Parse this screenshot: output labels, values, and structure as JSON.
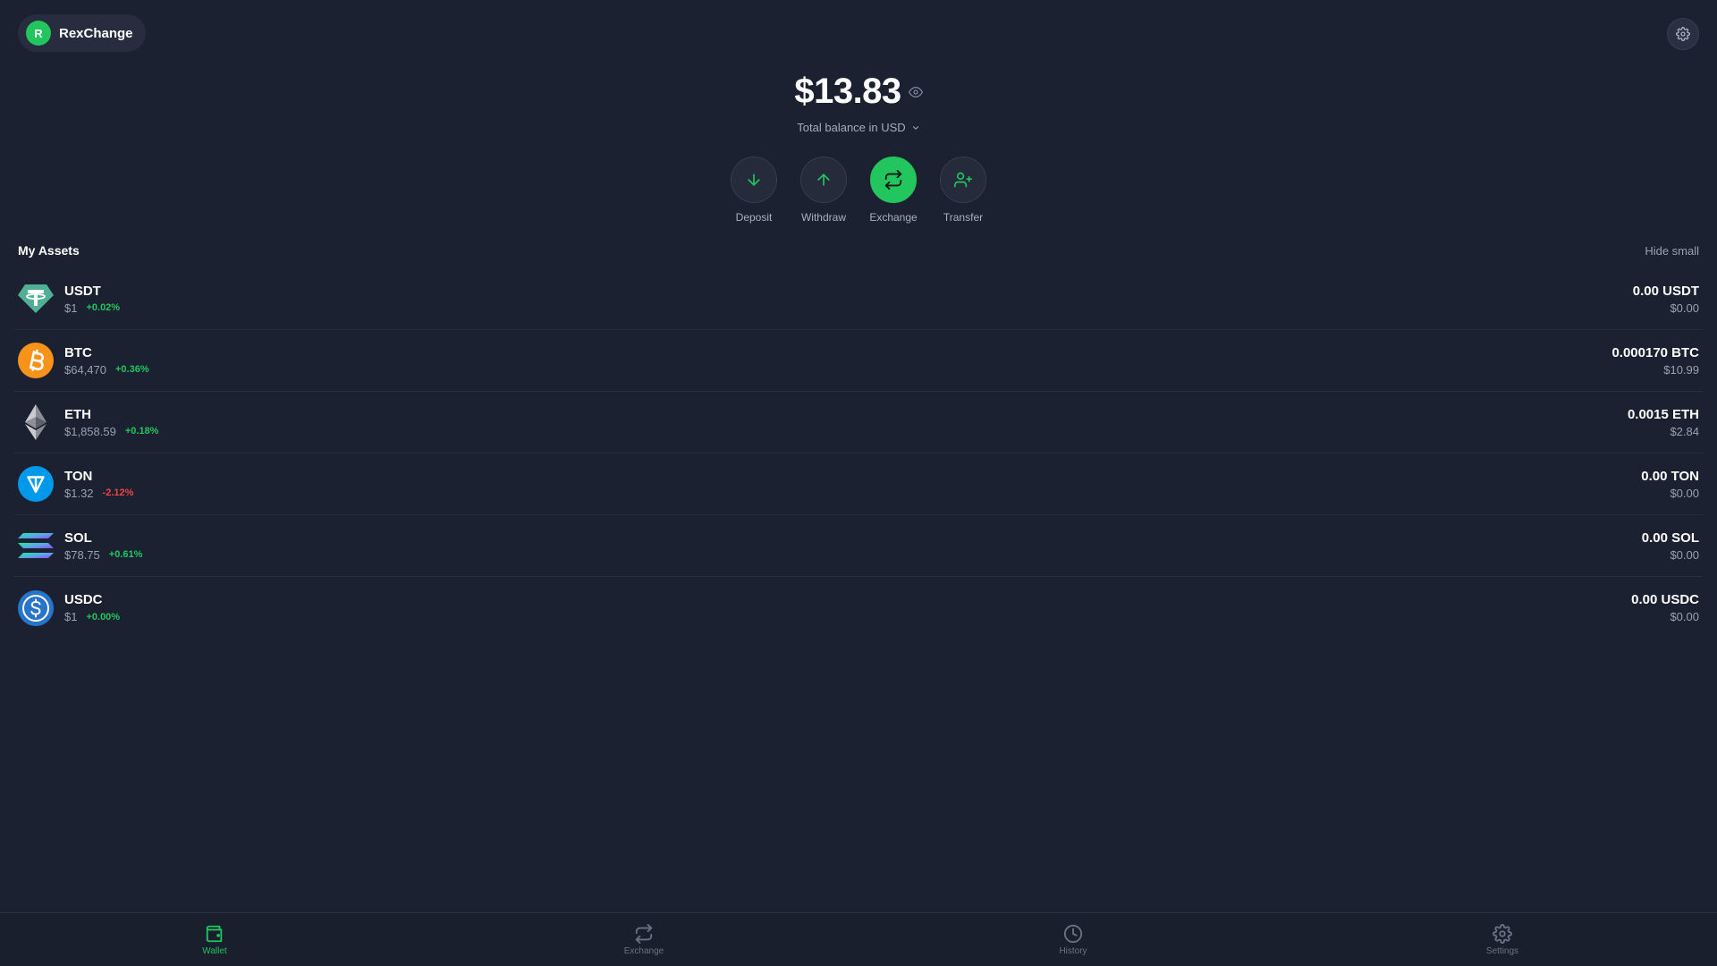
{
  "brand": {
    "avatar_letter": "R",
    "name": "RexChange"
  },
  "balance": {
    "amount": "$13.83",
    "subtitle": "Total balance in USD"
  },
  "actions": [
    {
      "label": "Deposit",
      "icon": "arrow-down-icon"
    },
    {
      "label": "Withdraw",
      "icon": "arrow-up-icon"
    },
    {
      "label": "Exchange",
      "icon": "exchange-icon"
    },
    {
      "label": "Transfer",
      "icon": "user-plus-icon"
    }
  ],
  "assets": {
    "title": "My Assets",
    "hide_small": "Hide small",
    "items": [
      {
        "symbol": "USDT",
        "price": "$1",
        "change": "+0.02%",
        "balance": "0.00 USDT",
        "usd": "$0.00"
      },
      {
        "symbol": "BTC",
        "price": "$64,470",
        "change": "+0.36%",
        "balance": "0.000170 BTC",
        "usd": "$10.99"
      },
      {
        "symbol": "ETH",
        "price": "$1,858.59",
        "change": "+0.18%",
        "balance": "0.0015 ETH",
        "usd": "$2.84"
      },
      {
        "symbol": "TON",
        "price": "$1.32",
        "change": "-2.12%",
        "balance": "0.00 TON",
        "usd": "$0.00"
      },
      {
        "symbol": "SOL",
        "price": "$78.75",
        "change": "+0.61%",
        "balance": "0.00 SOL",
        "usd": "$0.00"
      },
      {
        "symbol": "USDC",
        "price": "$1",
        "change": "+0.00%",
        "balance": "0.00 USDC",
        "usd": "$0.00"
      }
    ]
  },
  "nav": [
    {
      "label": "Wallet",
      "icon": "wallet-icon",
      "active": true
    },
    {
      "label": "Exchange",
      "icon": "exchange-icon",
      "active": false
    },
    {
      "label": "History",
      "icon": "clock-icon",
      "active": false
    },
    {
      "label": "Settings",
      "icon": "gear-icon",
      "active": false
    }
  ],
  "colors": {
    "background": "#1c2131",
    "accent": "#22c55e",
    "negative": "#ef4444",
    "usdt": "#50af95",
    "btc": "#f7931a",
    "ton": "#0098ea",
    "usdc": "#2775ca"
  }
}
